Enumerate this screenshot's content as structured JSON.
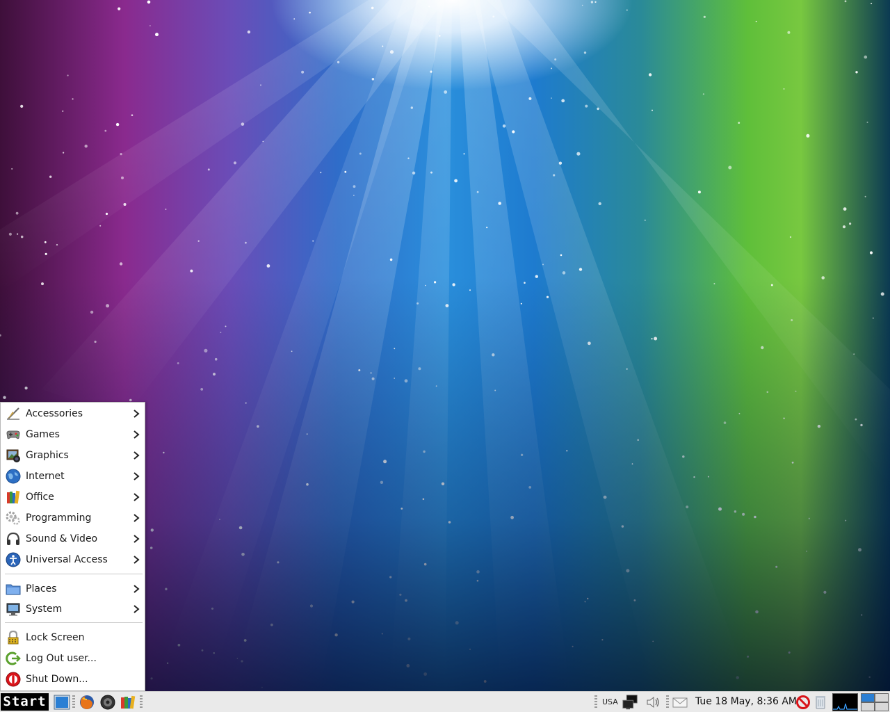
{
  "start_menu": {
    "categories": [
      {
        "label": "Accessories",
        "icon": "accessories-icon"
      },
      {
        "label": "Games",
        "icon": "gamepad-icon"
      },
      {
        "label": "Graphics",
        "icon": "graphics-icon"
      },
      {
        "label": "Internet",
        "icon": "globe-icon"
      },
      {
        "label": "Office",
        "icon": "office-icon"
      },
      {
        "label": "Programming",
        "icon": "gears-icon"
      },
      {
        "label": "Sound & Video",
        "icon": "headphones-icon"
      },
      {
        "label": "Universal Access",
        "icon": "accessibility-icon"
      }
    ],
    "places": {
      "label": "Places",
      "icon": "folder-icon"
    },
    "system": {
      "label": "System",
      "icon": "monitor-icon"
    },
    "actions": [
      {
        "label": "Lock Screen",
        "icon": "lock-icon"
      },
      {
        "label": "Log Out user...",
        "icon": "logout-icon"
      },
      {
        "label": "Shut Down...",
        "icon": "power-icon"
      }
    ]
  },
  "taskbar": {
    "start_label": "Start",
    "keyboard_layout": "USA",
    "clock": "Tue 18 May,  8:36 AM"
  },
  "colors": {
    "menu_bg": "#ffffff",
    "taskbar_bg": "#eaeaea",
    "start_bg": "#000000",
    "power_red": "#d9141a",
    "logout_green": "#5aa02c"
  }
}
